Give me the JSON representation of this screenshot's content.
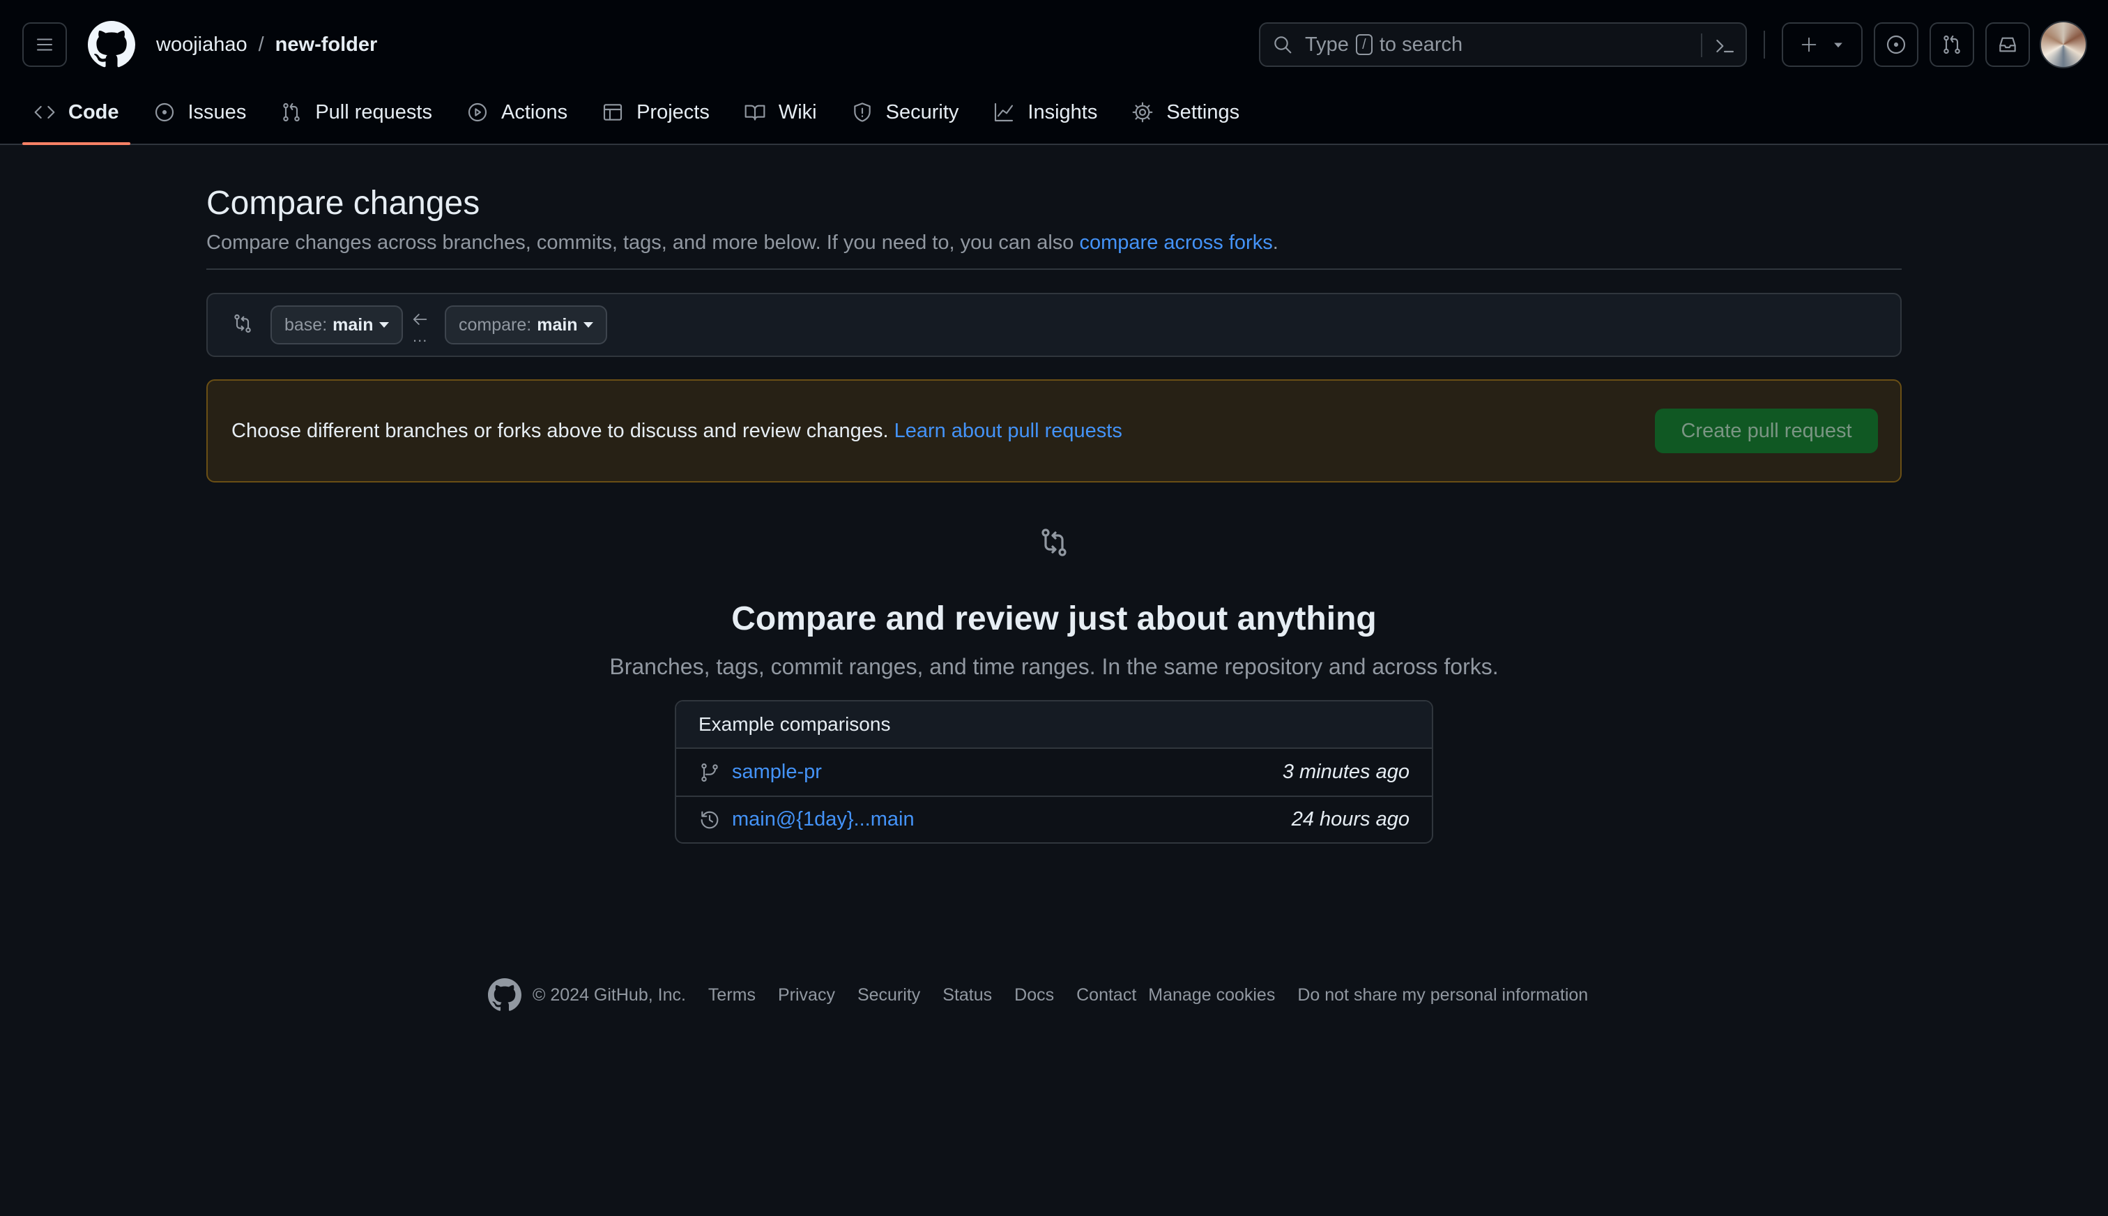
{
  "header": {
    "owner": "woojiahao",
    "separator": "/",
    "repo": "new-folder",
    "search": {
      "prefix": "Type",
      "key": "/",
      "suffix": "to search"
    }
  },
  "tabs": [
    {
      "label": "Code",
      "icon": "code-icon"
    },
    {
      "label": "Issues",
      "icon": "issue-icon"
    },
    {
      "label": "Pull requests",
      "icon": "pull-request-icon"
    },
    {
      "label": "Actions",
      "icon": "play-icon"
    },
    {
      "label": "Projects",
      "icon": "table-icon"
    },
    {
      "label": "Wiki",
      "icon": "book-icon"
    },
    {
      "label": "Security",
      "icon": "shield-icon"
    },
    {
      "label": "Insights",
      "icon": "graph-icon"
    },
    {
      "label": "Settings",
      "icon": "gear-icon"
    }
  ],
  "page": {
    "title": "Compare changes",
    "subtitle_prefix": "Compare changes across branches, commits, tags, and more below. If you need to, you can also",
    "subtitle_link": "compare across forks",
    "subtitle_suffix": "."
  },
  "range": {
    "base_label": "base:",
    "base_value": "main",
    "dots": "...",
    "compare_label": "compare:",
    "compare_value": "main"
  },
  "flash": {
    "message": "Choose different branches or forks above to discuss and review changes.",
    "link": "Learn about pull requests",
    "button": "Create pull request"
  },
  "blankslate": {
    "title": "Compare and review just about anything",
    "subtitle": "Branches, tags, commit ranges, and time ranges. In the same repository and across forks."
  },
  "examples": {
    "heading": "Example comparisons",
    "rows": [
      {
        "icon": "git-branch-icon",
        "link": "sample-pr",
        "time": "3 minutes ago"
      },
      {
        "icon": "history-icon",
        "link": "main@{1day}...main",
        "time": "24 hours ago"
      }
    ]
  },
  "footer": {
    "copyright": "© 2024 GitHub, Inc.",
    "links": [
      "Terms",
      "Privacy",
      "Security",
      "Status",
      "Docs",
      "Contact",
      "Manage cookies",
      "Do not share my personal information"
    ]
  },
  "colors": {
    "background": "#0d1117",
    "header": "#010409",
    "link": "#4493f8",
    "tab_underline": "#f78166",
    "create_button": "#105823",
    "flash_bg": "#272115"
  }
}
